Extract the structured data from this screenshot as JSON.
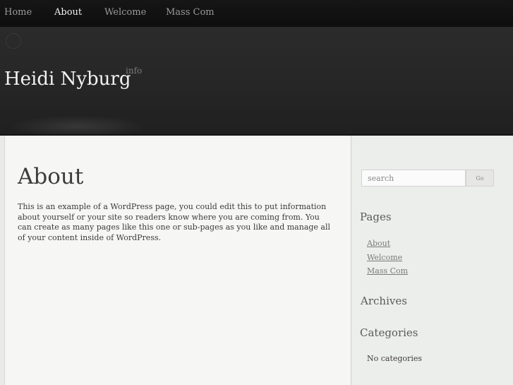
{
  "nav": {
    "items": [
      {
        "label": "Home",
        "active": false
      },
      {
        "label": "About",
        "active": true
      },
      {
        "label": "Welcome",
        "active": false
      },
      {
        "label": "Mass Com",
        "active": false
      }
    ]
  },
  "header": {
    "title": "Heidi Nyburg",
    "description": "info"
  },
  "content": {
    "title": "About",
    "body": "This is an example of a WordPress page, you could edit this to put information about yourself or your site so readers know where you are coming from. You can create as many pages like this one or sub-pages as you like and manage all of your content inside of WordPress."
  },
  "sidebar": {
    "search": {
      "placeholder": "search",
      "button_label": "Go"
    },
    "pages_title": "Pages",
    "pages": [
      "About",
      "Welcome",
      "Mass Com"
    ],
    "archives_title": "Archives",
    "categories_title": "Categories",
    "no_categories": "No categories"
  }
}
